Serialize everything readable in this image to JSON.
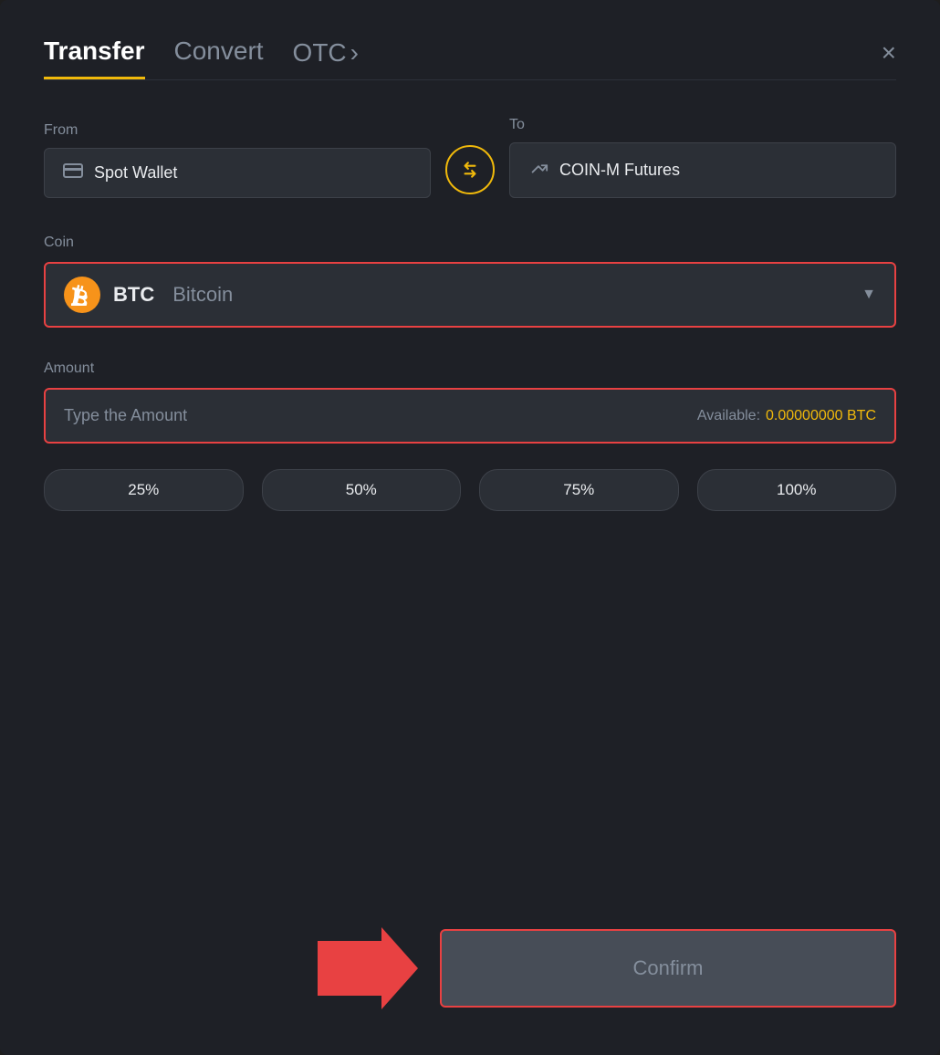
{
  "header": {
    "transfer_label": "Transfer",
    "convert_label": "Convert",
    "otc_label": "OTC",
    "otc_chevron": "›",
    "close_icon": "×"
  },
  "from_section": {
    "from_label": "From",
    "wallet_icon": "▬",
    "wallet_text": "Spot Wallet"
  },
  "swap": {
    "icon": "⇄"
  },
  "to_section": {
    "to_label": "To",
    "wallet_icon": "↑",
    "wallet_text": "COIN-M Futures"
  },
  "coin_section": {
    "label": "Coin",
    "coin_symbol": "BTC",
    "coin_name": "Bitcoin",
    "chevron": "▼"
  },
  "amount_section": {
    "label": "Amount",
    "placeholder": "Type the Amount",
    "available_label": "Available:",
    "available_value": "0.00000000 BTC"
  },
  "percentage_buttons": [
    {
      "label": "25%"
    },
    {
      "label": "50%"
    },
    {
      "label": "75%"
    },
    {
      "label": "100%"
    }
  ],
  "confirm_button": {
    "label": "Confirm"
  },
  "colors": {
    "accent": "#f0b90b",
    "danger": "#e84142",
    "muted": "#848e9c"
  }
}
